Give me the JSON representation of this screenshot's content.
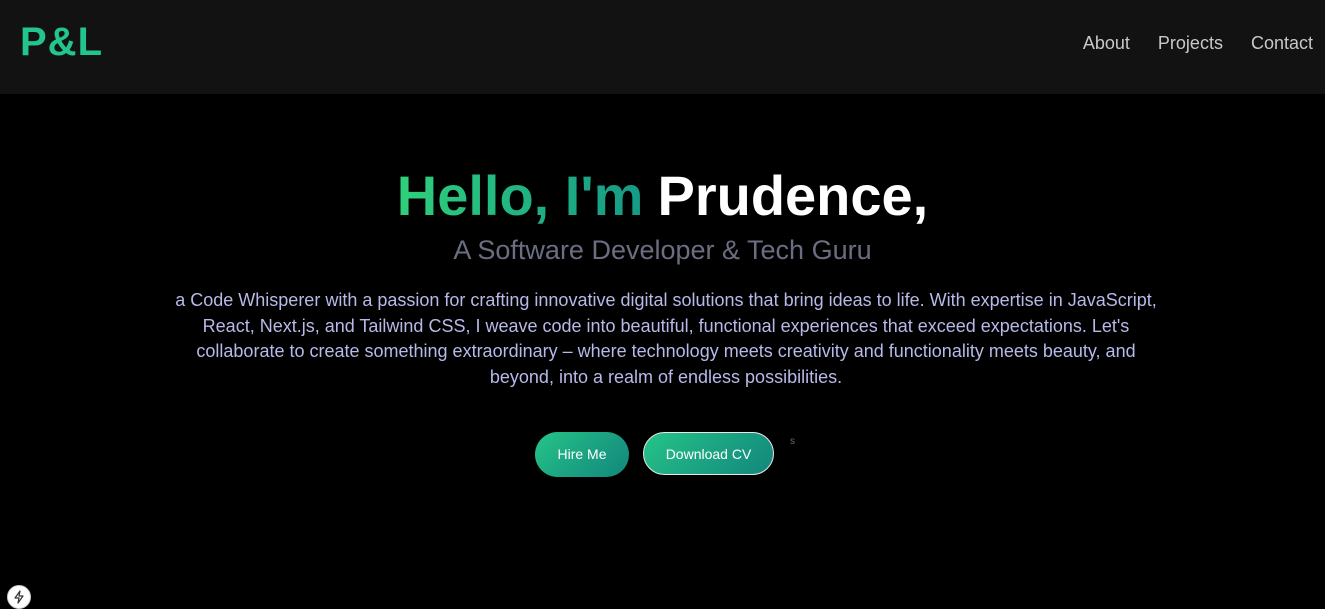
{
  "nav": {
    "logo": "P&L",
    "links": [
      "About",
      "Projects",
      "Contact"
    ]
  },
  "hero": {
    "greeting": "Hello, I'm",
    "name": "Prudence,",
    "subtitle": "A Software Developer & Tech Guru",
    "bio": "a Code Whisperer with a passion for crafting innovative digital solutions that bring ideas to life. With expertise in JavaScript, React, Next.js, and Tailwind CSS, I weave code into beautiful, functional experiences that exceed expectations. Let's collaborate to create something extraordinary – where technology meets creativity and functionality meets beauty, and beyond, into a realm of endless possibilities.",
    "buttons": {
      "hire": "Hire Me",
      "cv": "Download CV"
    },
    "stray_text": "s"
  },
  "icons": {
    "corner_badge": "lightning-bolt-icon"
  },
  "colors": {
    "accent": "#22c58b",
    "background": "#000000",
    "navbar": "#121212",
    "subtitle": "#6a6e80",
    "bio": "#b7b9e8"
  }
}
